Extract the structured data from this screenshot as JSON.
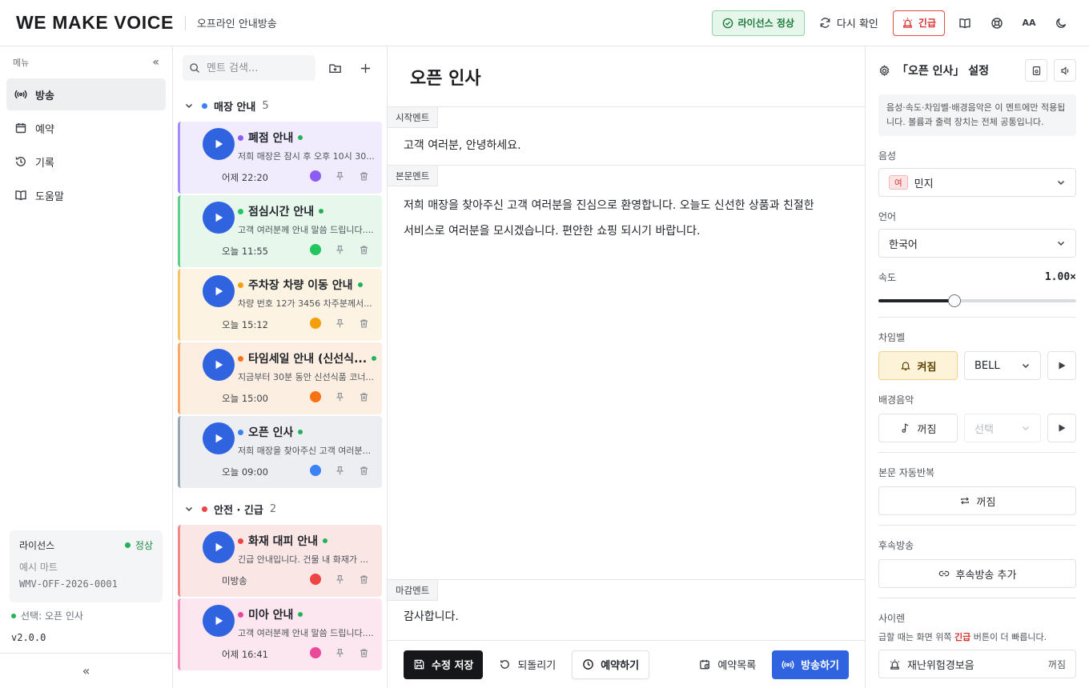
{
  "header": {
    "brand": "WE MAKE VOICE",
    "subtitle": "오프라인 안내방송",
    "license_badge": "라이선스 정상",
    "recheck": "다시 확인",
    "emergency": "긴급",
    "font_size_label": "AA"
  },
  "sidebar": {
    "menu_label": "메뉴",
    "items": [
      {
        "label": "방송",
        "icon": "broadcast-icon"
      },
      {
        "label": "예약",
        "icon": "calendar-icon"
      },
      {
        "label": "기록",
        "icon": "history-icon"
      },
      {
        "label": "도움말",
        "icon": "book-icon"
      }
    ],
    "license": {
      "title": "라이선스",
      "status": "정상",
      "name": "예시 마트",
      "code": "WMV-OFF-2026-0001"
    },
    "selected": "선택: 오픈 인사",
    "version": "v2.0.0"
  },
  "list": {
    "search_placeholder": "멘트 검색...",
    "groups": [
      {
        "title": "매장 안내",
        "count": "5",
        "color": "#3b82f6"
      },
      {
        "title": "안전 · 긴급",
        "count": "2",
        "color": "#ef4444"
      }
    ],
    "cards": [
      {
        "title": "폐점 안내",
        "desc": "저희 매장은 잠시 후 오후 10시 30...",
        "time": "어제 22:20",
        "color": "#8b5cf6",
        "bg": "#f1ecfd",
        "border": "#a78bfa"
      },
      {
        "title": "점심시간 안내",
        "desc": "고객 여러분께 안내 말씀 드립니다....",
        "time": "오늘 11:55",
        "color": "#22c55e",
        "bg": "#e7f7ec",
        "border": "#5fd08a"
      },
      {
        "title": "주차장 차량 이동 안내",
        "desc": "차량 번호 12가 3456 차주분께서...",
        "time": "오늘 15:12",
        "color": "#f59e0b",
        "bg": "#fdf3e2",
        "border": "#f6c46a"
      },
      {
        "title": "타임세일 안내 (신선식...",
        "desc": "지금부터 30분 동안 신선식품 코너...",
        "time": "오늘 15:00",
        "color": "#f97316",
        "bg": "#fdeee2",
        "border": "#f8a66a"
      },
      {
        "title": "오픈 인사",
        "desc": "저희 매장을 찾아주신 고객 여러분...",
        "time": "오늘 09:00",
        "color": "#3b82f6",
        "bg": "#eceef1",
        "border": "#9aa6b8"
      },
      {
        "title": "화재 대피 안내",
        "desc": "긴급 안내입니다. 건물 내 화재가 ...",
        "time": "미방송",
        "color": "#ef4444",
        "bg": "#fbe6e6",
        "border": "#f08a8a"
      },
      {
        "title": "미아 안내",
        "desc": "고객 여러분께 안내 말씀 드립니다....",
        "time": "어제 16:41",
        "color": "#ec4899",
        "bg": "#fce6ef",
        "border": "#f38cb8"
      }
    ]
  },
  "main": {
    "title": "오픈 인사",
    "start_label": "시작멘트",
    "start_text": "고객 여러분, 안녕하세요.",
    "body_label": "본문멘트",
    "body_text": "저희 매장을 찾아주신 고객 여러분을 진심으로 환영합니다. 오늘도 신선한 상품과 친절한 서비스로 여러분을 모시겠습니다. 편안한 쇼핑 되시기 바랍니다.",
    "end_label": "마감멘트",
    "end_text": "감사합니다.",
    "save": "수정 저장",
    "revert": "되돌리기",
    "reserve": "예약하기",
    "reserve_list": "예약목록",
    "broadcast": "방송하기"
  },
  "panel": {
    "title": "「오픈 인사」 설정",
    "note": "음성·속도·차임벨·배경음악은 이 멘트에만 적용됩니다. 볼륨과 출력 장치는 전체 공통입니다.",
    "voice_label": "음성",
    "voice_tag": "여",
    "voice": "민지",
    "lang_label": "언어",
    "lang": "한국어",
    "speed_label": "속도",
    "speed_value": "1.00×",
    "speed_fraction": 0.385,
    "chime_label": "차임벨",
    "chime_state": "켜짐",
    "chime_sound": "BELL",
    "bgm_label": "배경음악",
    "bgm_state": "꺼짐",
    "bgm_select": "선택",
    "repeat_label": "본문 자동반복",
    "repeat_state": "꺼짐",
    "followup_label": "후속방송",
    "followup_add": "후속방송 추가",
    "siren_label": "사이렌",
    "siren_note_pre": "급할 때는 화면 위쪽 ",
    "siren_note_em": "긴급",
    "siren_note_post": " 버튼이 더 빠릅니다.",
    "siren_item": "재난위험경보음",
    "siren_state": "꺼짐"
  }
}
